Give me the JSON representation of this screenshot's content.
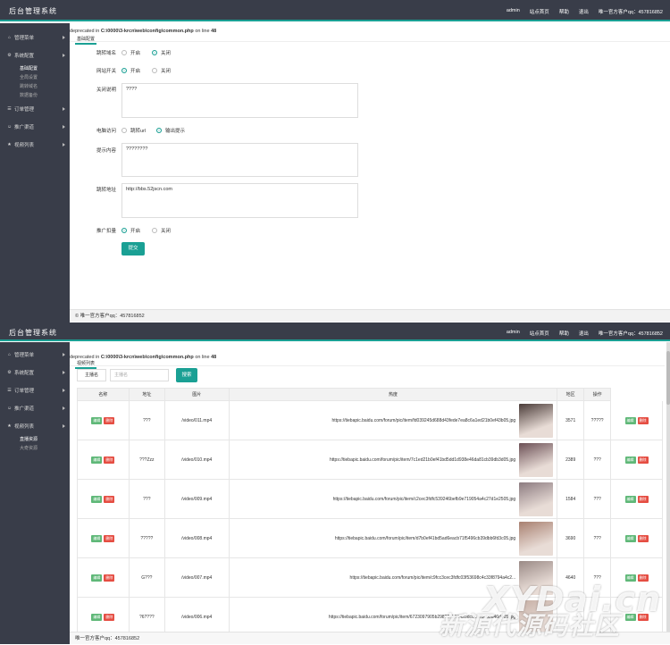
{
  "header": {
    "brand": "后台管理系统",
    "nav": [
      "admin",
      "站点首页",
      "帮助",
      "退出",
      "唯一官方客户qq：457816852"
    ],
    "nav_bottom": [
      "admin",
      "站点首页",
      "帮助",
      "退出",
      "唯一官方客户qq：457816852"
    ]
  },
  "sidebar_top": {
    "menus": [
      {
        "label": "管理菜单",
        "icon": "home-icon"
      },
      {
        "label": "系统配置",
        "icon": "settings-icon"
      },
      {
        "label": "订单管理",
        "icon": "list-icon"
      },
      {
        "label": "推广渠道",
        "icon": "people-icon"
      },
      {
        "label": "视频列表",
        "icon": "star-icon"
      }
    ],
    "sub": [
      "基础配置",
      "全局设置",
      "跳转域名",
      "数据备份"
    ]
  },
  "sidebar_bottom": {
    "menus": [
      {
        "label": "管理菜单",
        "icon": "home-icon"
      },
      {
        "label": "系统配置",
        "icon": "settings-icon"
      },
      {
        "label": "订单管理",
        "icon": "list-icon"
      },
      {
        "label": "推广渠道",
        "icon": "people-icon"
      },
      {
        "label": "视频列表",
        "icon": "star-icon"
      }
    ],
    "sub": [
      "直播资源",
      "大奇资源"
    ]
  },
  "warning": {
    "prefix": "deprecated in",
    "path": "C:\\0000\\3-krcn\\web\\config\\common.php",
    "on_line": "on line",
    "line": "48",
    "tab": "基础配置",
    "tab_bottom": "视频列表"
  },
  "form": {
    "fields": [
      {
        "label": "跳转域名",
        "opt1": "开启",
        "opt2": "关闭",
        "selected": 2
      },
      {
        "label": "网站开关",
        "opt1": "开启",
        "opt2": "关闭",
        "selected": 1
      }
    ],
    "close_label": "关闭说明",
    "close_value": "????",
    "pc_label": "电脑访问",
    "pc_opt1": "跳转url",
    "pc_opt2": "输出提示",
    "tip_label": "提示内容",
    "tip_value": "????????",
    "jump_label": "跳转地址",
    "jump_value": "http://bbs.52jscn.com",
    "promo_label": "推广扣量",
    "promo_opt1": "开启",
    "promo_opt2": "关闭",
    "submit": "提交"
  },
  "footer": {
    "top": "© 唯一官方客户qq：457816852",
    "bottom": "唯一官方客户qq：457816852"
  },
  "search": {
    "category": "主播名",
    "placeholder": "主播名",
    "button": "搜索"
  },
  "table": {
    "headers": [
      "名称",
      "地址",
      "图片",
      "热度",
      "地区",
      "操作"
    ],
    "edit": "编辑",
    "delete": "删除",
    "rows": [
      {
        "name": "???",
        "addr": "/video/011.mp4",
        "url": "https://tiebapic.baidu.com/forum/pic/item/fd039245d688d43fede7ea8c6a1ed21b0ef43b05.jpg",
        "region": "3571",
        "op": "?????",
        "thumb": "#4a3b38"
      },
      {
        "name": "???Zzz",
        "addr": "/video/010.mp4",
        "url": "https://tiebapic.baidu.com/forum/pic/item/7c1ed21b0ef41bd5dd1d938e46da81cb39db3d05.jpg",
        "region": "2389",
        "op": "???",
        "thumb": "#6b4f55"
      },
      {
        "name": "???",
        "addr": "/video/009.mp4",
        "url": "https://tiebapic.baidu.com/forum/pic/item/c2cec3fdfc539246befb9e719054a4c27d1e2505.jpg",
        "region": "1584",
        "op": "???",
        "thumb": "#8c7b80"
      },
      {
        "name": "?????",
        "addr": "/video/008.mp4",
        "url": "https://tiebapic.baidu.com/forum/pic/item/d7b0ef41bd5ad6eacb71f5496cb39dbb6fd3c05.jpg",
        "region": "3690",
        "op": "???",
        "thumb": "#a88070"
      },
      {
        "name": "G???",
        "addr": "/video/007.mp4",
        "url": "https://tiebapic.baidu.com/forum/pic/item/c9fcc3cec3fdfc03f53698c4c33f8794a4c2...",
        "region": "4640",
        "op": "???",
        "thumb": "#9a8a86"
      },
      {
        "name": "?6????",
        "addr": "/video/006.mp4",
        "url": "https://tiebapic.baidu.com/forum/pic/item/6723097905b29822ab6842bdc0ca7bcb0a46d405.jpg",
        "region": "",
        "op": "",
        "thumb": "#c7b0a6"
      }
    ]
  },
  "watermark": {
    "line1": "XYDai.cn",
    "line2": "新源代源码社区"
  },
  "colors": {
    "accent": "#1aa094",
    "sidebar": "#393d49",
    "edit": "#5fb878",
    "delete": "#e54d42"
  }
}
